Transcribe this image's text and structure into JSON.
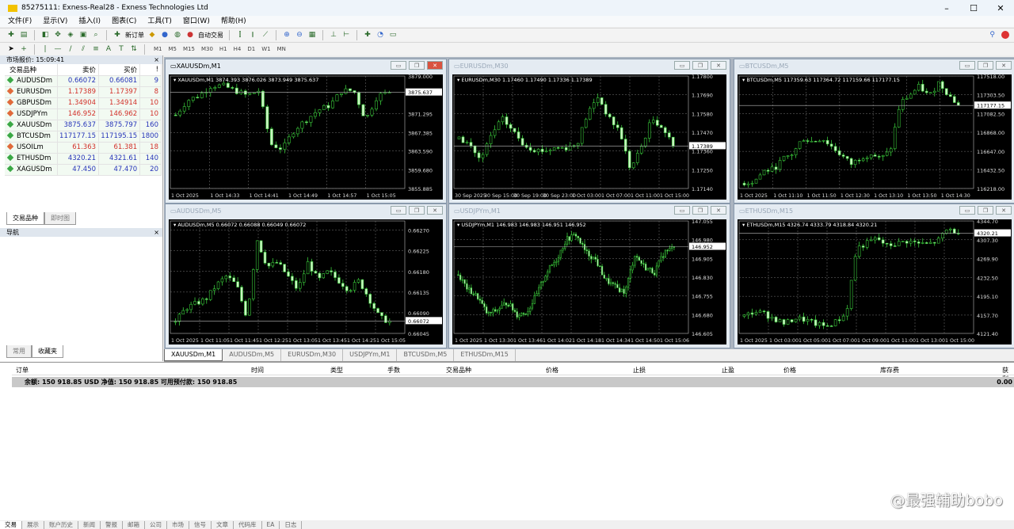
{
  "window": {
    "title": "85275111: Exness-Real28 - Exness Technologies Ltd",
    "minimize": "–",
    "maximize": "☐",
    "close": "✕"
  },
  "menu": [
    "文件(F)",
    "显示(V)",
    "插入(I)",
    "图表(C)",
    "工具(T)",
    "窗口(W)",
    "帮助(H)"
  ],
  "toolbar": {
    "new_order": "新订单",
    "auto_trading": "自动交易"
  },
  "timeframes": [
    "M1",
    "M5",
    "M15",
    "M30",
    "H1",
    "H4",
    "D1",
    "W1",
    "MN"
  ],
  "market_watch": {
    "title": "市场报价: 15:09:41",
    "headers": [
      "交易品种",
      "卖价",
      "买价",
      "!"
    ],
    "rows": [
      {
        "symbol": "AUDUSDm",
        "bid": "0.66072",
        "ask": "0.66081",
        "spread": "9",
        "dir": "up"
      },
      {
        "symbol": "EURUSDm",
        "bid": "1.17389",
        "ask": "1.17397",
        "spread": "8",
        "dir": "dn"
      },
      {
        "symbol": "GBPUSDm",
        "bid": "1.34904",
        "ask": "1.34914",
        "spread": "10",
        "dir": "dn"
      },
      {
        "symbol": "USDJPYm",
        "bid": "146.952",
        "ask": "146.962",
        "spread": "10",
        "dir": "dn"
      },
      {
        "symbol": "XAUUSDm",
        "bid": "3875.637",
        "ask": "3875.797",
        "spread": "160",
        "dir": "up"
      },
      {
        "symbol": "BTCUSDm",
        "bid": "117177.15",
        "ask": "117195.15",
        "spread": "1800",
        "dir": "up"
      },
      {
        "symbol": "USOILm",
        "bid": "61.363",
        "ask": "61.381",
        "spread": "18",
        "dir": "dn"
      },
      {
        "symbol": "ETHUSDm",
        "bid": "4320.21",
        "ask": "4321.61",
        "spread": "140",
        "dir": "up"
      },
      {
        "symbol": "XAGUSDm",
        "bid": "47.450",
        "ask": "47.470",
        "spread": "20",
        "dir": "up"
      }
    ],
    "tabs": [
      "交易品种",
      "即时图"
    ]
  },
  "navigator": {
    "title": "导航",
    "tabs": [
      "常用",
      "收藏夹"
    ]
  },
  "colors": {
    "up": "#2633b8",
    "down": "#d2302a",
    "candle": "#39c83a",
    "candle_fill": "#c8f5c0"
  },
  "charts": [
    {
      "title": "XAUUSDm,M1",
      "legend": "XAUUSDm,M1  3874.393 3876.026 3873.949 3875.637",
      "range": [
        3855.885,
        3879.0
      ],
      "price_ticks": [
        "3879.000",
        "3871.295",
        "3867.385",
        "3863.590",
        "3859.680",
        "3855.885"
      ],
      "current": "3875.637",
      "current_value": 3875.637,
      "time_ticks": [
        "1 Oct 2025",
        "1 Oct 14:33",
        "1 Oct 14:41",
        "1 Oct 14:49",
        "1 Oct 14:57",
        "1 Oct 15:05"
      ],
      "closes": [
        3871,
        3874,
        3875,
        3877,
        3877,
        3876,
        3875,
        3876,
        3865,
        3864,
        3868,
        3870,
        3872,
        3873,
        3876,
        3876,
        3870,
        3875,
        3875.6
      ],
      "bars": 50
    },
    {
      "title": "EURUSDm,M30",
      "legend": "EURUSDm,M30  1.17460 1.17490 1.17336 1.17389",
      "range": [
        1.1714,
        1.178
      ],
      "price_ticks": [
        "1.17800",
        "1.17690",
        "1.17580",
        "1.17470",
        "1.17360",
        "1.17250",
        "1.17140"
      ],
      "current": "1.17389",
      "current_value": 1.17389,
      "time_ticks": [
        "30 Sep 2025",
        "30 Sep 15:00",
        "30 Sep 19:00",
        "30 Sep 23:00",
        "1 Oct 03:00",
        "1 Oct 07:00",
        "1 Oct 11:00",
        "1 Oct 15:00"
      ],
      "closes": [
        1.1743,
        1.174,
        1.173,
        1.1745,
        1.1755,
        1.1748,
        1.174,
        1.1737,
        1.1736,
        1.1738,
        1.1738,
        1.174,
        1.1758,
        1.1768,
        1.1755,
        1.1748,
        1.1725,
        1.1738,
        1.1755,
        1.175,
        1.1739
      ],
      "bars": 55
    },
    {
      "title": "BTCUSDm,M5",
      "legend": "BTCUSDm,M5  117359.63 117364.72 117159.66 117177.15",
      "range": [
        116218,
        117518
      ],
      "price_ticks": [
        "117518.00",
        "117303.50",
        "117082.50",
        "116868.00",
        "116647.00",
        "116432.50",
        "116218.00"
      ],
      "current": "117177.15",
      "current_value": 117177.15,
      "time_ticks": [
        "1 Oct 2025",
        "1 Oct 11:10",
        "1 Oct 11:50",
        "1 Oct 12:30",
        "1 Oct 13:10",
        "1 Oct 13:50",
        "1 Oct 14:30"
      ],
      "closes": [
        116280,
        116300,
        116420,
        116440,
        116560,
        116620,
        116800,
        116760,
        116800,
        116700,
        116600,
        116500,
        116580,
        116620,
        116560,
        116650,
        117200,
        117300,
        117400,
        117280,
        117450,
        117300,
        117177
      ],
      "bars": 55
    },
    {
      "title": "AUDUSDm,M5",
      "legend": "AUDUSDm,M5  0.66072 0.66088 0.66049 0.66072",
      "range": [
        0.66045,
        0.6629
      ],
      "price_ticks": [
        "0.66270",
        "0.66225",
        "0.66180",
        "0.66135",
        "0.66090",
        "0.66045"
      ],
      "current": "0.66072",
      "current_value": 0.66072,
      "time_ticks": [
        "1 Oct 2025",
        "1 Oct 11:05",
        "1 Oct 11:45",
        "1 Oct 12:25",
        "1 Oct 13:05",
        "1 Oct 13:45",
        "1 Oct 14:25",
        "1 Oct 15:05"
      ],
      "closes": [
        0.6607,
        0.661,
        0.6611,
        0.6612,
        0.6615,
        0.6617,
        0.6615,
        0.6608,
        0.6625,
        0.6619,
        0.662,
        0.6617,
        0.6614,
        0.662,
        0.6616,
        0.6618,
        0.6616,
        0.6614,
        0.6616,
        0.6612,
        0.6608,
        0.6607
      ],
      "bars": 56
    },
    {
      "title": "USDJPYm,M1",
      "legend": "USDJPYm,M1  146.983 146.983 146.951 146.952",
      "range": [
        146.605,
        147.055
      ],
      "price_ticks": [
        "147.055",
        "146.980",
        "146.905",
        "146.830",
        "146.755",
        "146.680",
        "146.605"
      ],
      "current": "146.952",
      "current_value": 146.952,
      "time_ticks": [
        "1 Oct 2025",
        "1 Oct 13:30",
        "1 Oct 13:46",
        "1 Oct 14:02",
        "1 Oct 14:18",
        "1 Oct 14:34",
        "1 Oct 14:50",
        "1 Oct 15:06"
      ],
      "closes": [
        146.84,
        146.78,
        146.75,
        146.68,
        146.7,
        146.73,
        146.68,
        146.69,
        146.76,
        146.85,
        146.9,
        146.98,
        147.0,
        146.93,
        146.9,
        146.82,
        146.79,
        146.77,
        146.92,
        146.87,
        146.85,
        146.93,
        146.95
      ],
      "bars": 100
    },
    {
      "title": "ETHUSDm,M15",
      "legend": "ETHUSDm,M15  4326.74 4333.79 4318.84 4320.21",
      "range": [
        4121.4,
        4344.7
      ],
      "price_ticks": [
        "4344.70",
        "4307.30",
        "4269.90",
        "4232.50",
        "4195.10",
        "4157.70",
        "4121.40"
      ],
      "current": "4320.21",
      "current_value": 4320.21,
      "time_ticks": [
        "1 Oct 2025",
        "1 Oct 03:00",
        "1 Oct 05:00",
        "1 Oct 07:00",
        "1 Oct 09:00",
        "1 Oct 11:00",
        "1 Oct 13:00",
        "1 Oct 15:00"
      ],
      "closes": [
        4155,
        4165,
        4160,
        4150,
        4140,
        4152,
        4148,
        4140,
        4135,
        4145,
        4160,
        4290,
        4300,
        4310,
        4295,
        4300,
        4305,
        4300,
        4298,
        4305,
        4330,
        4320
      ],
      "bars": 55
    }
  ],
  "chart_tabs": [
    "XAUUSDm,M1",
    "AUDUSDm,M5",
    "EURUSDm,M30",
    "USDJPYm,M1",
    "BTCUSDm,M5",
    "ETHUSDm,M15"
  ],
  "terminal": {
    "headers": [
      "订单",
      "时间",
      "类型",
      "手数",
      "交易品种",
      "价格",
      "止损",
      "止盈",
      "价格",
      "库存费",
      "获利"
    ],
    "balance": "余额: 150 918.85 USD  净值: 150 918.85  可用预付款: 150 918.85",
    "profit": "0.00",
    "tabs": [
      "交易",
      "展示",
      "账户历史",
      "新闻",
      "警报",
      "邮箱",
      "公司",
      "市场",
      "信号",
      "文章",
      "代码库",
      "EA",
      "日志"
    ]
  },
  "watermark": "@最强辅助bobo"
}
